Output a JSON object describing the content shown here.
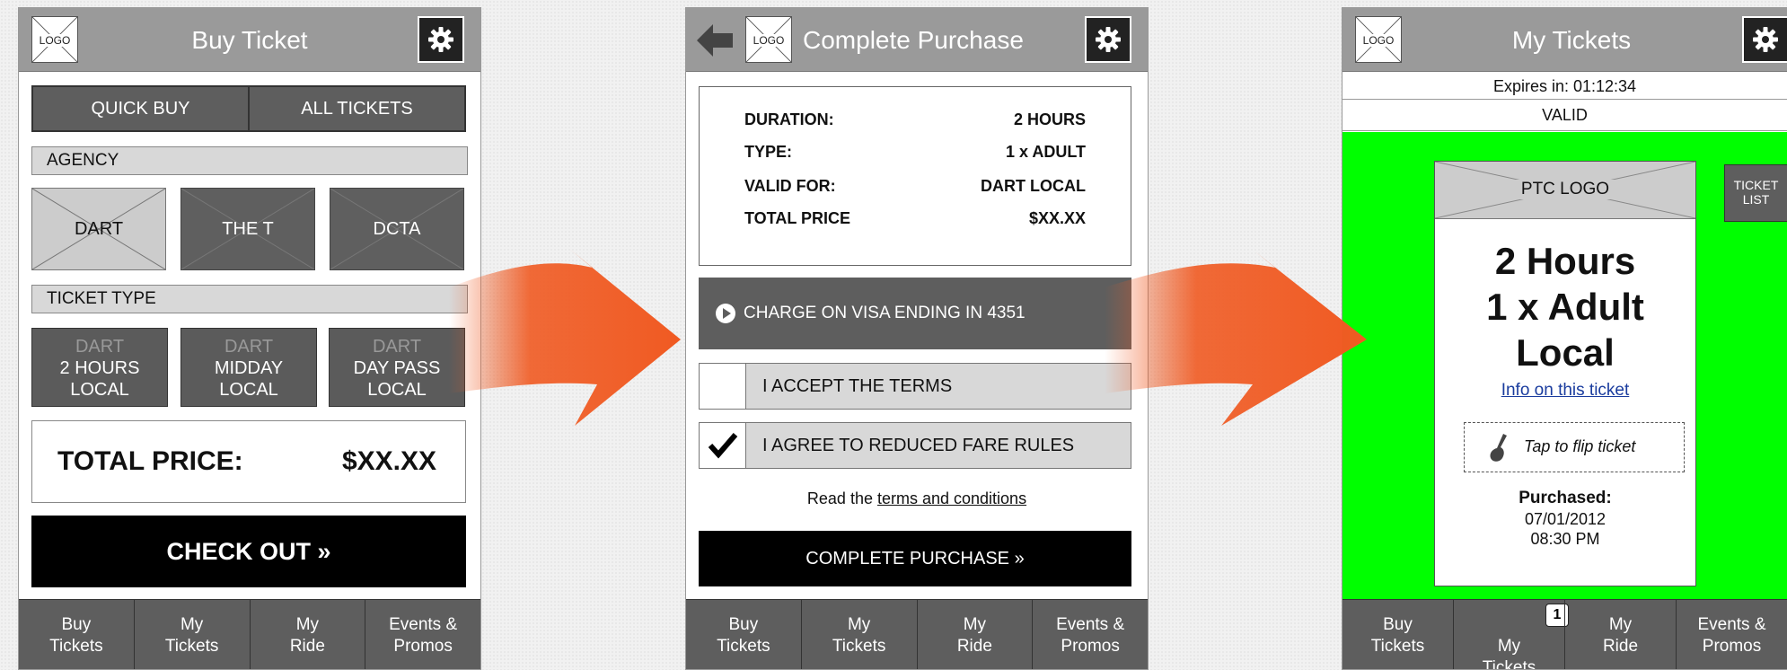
{
  "screen1": {
    "title": "Buy Ticket",
    "logo": "LOGO",
    "tabs": [
      "QUICK BUY",
      "ALL TICKETS"
    ],
    "agency_label": "AGENCY",
    "agencies": [
      "DART",
      "THE T",
      "DCTA"
    ],
    "ticket_type_label": "TICKET TYPE",
    "ticket_types": [
      {
        "agency": "DART",
        "line1": "2 HOURS",
        "line2": "LOCAL"
      },
      {
        "agency": "DART",
        "line1": "MIDDAY",
        "line2": "LOCAL"
      },
      {
        "agency": "DART",
        "line1": "DAY PASS",
        "line2": "LOCAL"
      }
    ],
    "total_label": "TOTAL PRICE:",
    "total_value": "$XX.XX",
    "checkout": "CHECK OUT »"
  },
  "screen2": {
    "title": "Complete Purchase",
    "logo": "LOGO",
    "summary": [
      {
        "label": "DURATION:",
        "value": "2 HOURS"
      },
      {
        "label": "TYPE:",
        "value": "1 x ADULT"
      },
      {
        "label": "VALID FOR:",
        "value": "DART LOCAL"
      },
      {
        "label": "TOTAL PRICE",
        "value": "$XX.XX"
      }
    ],
    "charge": "CHARGE ON VISA ENDING IN 4351",
    "accept_terms": "I ACCEPT THE TERMS",
    "agree_rules": "I AGREE TO REDUCED FARE RULES",
    "read_prefix": "Read the",
    "terms_link": "terms and conditions",
    "complete_button": "COMPLETE PURCHASE »"
  },
  "screen3": {
    "title": "My Tickets",
    "logo": "LOGO",
    "expires": "Expires in: 01:12:34",
    "status": "VALID",
    "ptc_logo": "PTC LOGO",
    "ticket_list": "TICKET LIST",
    "ticket_lines": [
      "2 Hours",
      "1 x Adult",
      "Local"
    ],
    "info_link": "Info on this ticket",
    "flip": "Tap to flip ticket",
    "purchased_label": "Purchased:",
    "purchased_date": "07/01/2012",
    "purchased_time": "08:30 PM",
    "badge_count": "1"
  },
  "nav": [
    "Buy\nTickets",
    "My\nTickets",
    "My\nRide",
    "Events &\nPromos"
  ],
  "colors": {
    "arrow": "#f05a22",
    "ticket_bg": "#00ff00",
    "header": "#9a9a9a",
    "dark": "#5e5e5e"
  }
}
